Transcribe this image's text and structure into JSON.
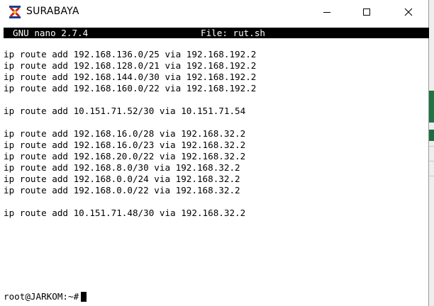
{
  "window": {
    "title": "SURABAYA"
  },
  "nano": {
    "version": "GNU nano 2.7.4",
    "file_label": "File: rut.sh"
  },
  "lines": [
    "ip route add 192.168.136.0/25 via 192.168.192.2",
    "ip route add 192.168.128.0/21 via 192.168.192.2",
    "ip route add 192.168.144.0/30 via 192.168.192.2",
    "ip route add 192.168.160.0/22 via 192.168.192.2",
    "",
    "ip route add 10.151.71.52/30 via 10.151.71.54",
    "",
    "ip route add 192.168.16.0/28 via 192.168.32.2",
    "ip route add 192.168.16.0/23 via 192.168.32.2",
    "ip route add 192.168.20.0/22 via 192.168.32.2",
    "ip route add 192.168.8.0/30 via 192.168.32.2",
    "ip route add 192.168.0.0/24 via 192.168.32.2",
    "ip route add 192.168.0.0/22 via 192.168.32.2",
    "",
    "ip route add 10.151.71.48/30 via 192.168.32.2"
  ],
  "prompt": "root@JARKOM:~#",
  "icons": {
    "app": "putty-app-icon",
    "minimize": "minimize-icon",
    "maximize": "maximize-icon",
    "close": "close-icon"
  },
  "colors": {
    "header_bg": "#000000",
    "header_fg": "#ffffff",
    "terminal_bg": "#ffffff",
    "terminal_fg": "#000000",
    "background_app_accent": "#217346"
  }
}
